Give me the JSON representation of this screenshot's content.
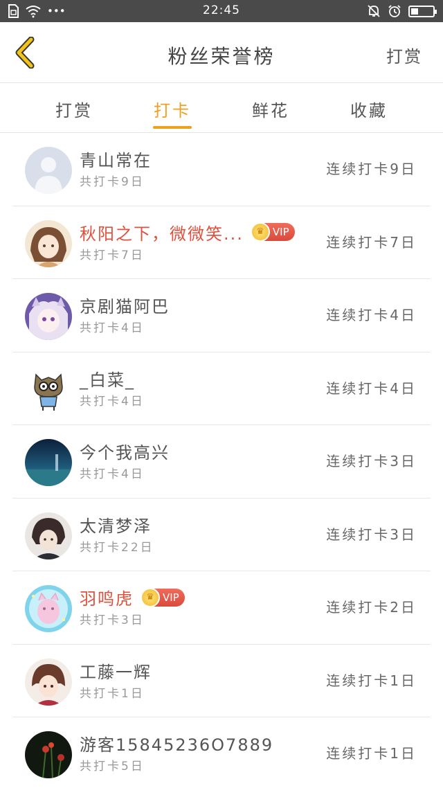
{
  "status_bar": {
    "time": "22:45"
  },
  "header": {
    "title": "粉丝荣誉榜",
    "action": "打赏"
  },
  "tabs": [
    {
      "label": "打赏",
      "active": false
    },
    {
      "label": "打卡",
      "active": true
    },
    {
      "label": "鲜花",
      "active": false
    },
    {
      "label": "收藏",
      "active": false
    }
  ],
  "colors": {
    "accent": "#f0a020",
    "vip_name": "#e0503c",
    "vip_badge": "#e35d4d"
  },
  "vip_label": "VIP",
  "fans": [
    {
      "name": "青山常在",
      "total": "共打卡9日",
      "streak": "连续打卡9日",
      "vip": false
    },
    {
      "name": "秋阳之下，微微笑...",
      "total": "共打卡7日",
      "streak": "连续打卡7日",
      "vip": true
    },
    {
      "name": "京剧猫阿巴",
      "total": "共打卡4日",
      "streak": "连续打卡4日",
      "vip": false
    },
    {
      "name": "_白菜_",
      "total": "共打卡4日",
      "streak": "连续打卡4日",
      "vip": false
    },
    {
      "name": "今个我高兴",
      "total": "共打卡4日",
      "streak": "连续打卡3日",
      "vip": false
    },
    {
      "name": "太清梦泽",
      "total": "共打卡22日",
      "streak": "连续打卡3日",
      "vip": false
    },
    {
      "name": "羽鸣虎",
      "total": "共打卡3日",
      "streak": "连续打卡2日",
      "vip": true
    },
    {
      "name": "工藤一辉",
      "total": "共打卡1日",
      "streak": "连续打卡1日",
      "vip": false
    },
    {
      "name": "游客15845236O7889",
      "total": "共打卡5日",
      "streak": "连续打卡1日",
      "vip": false
    }
  ]
}
